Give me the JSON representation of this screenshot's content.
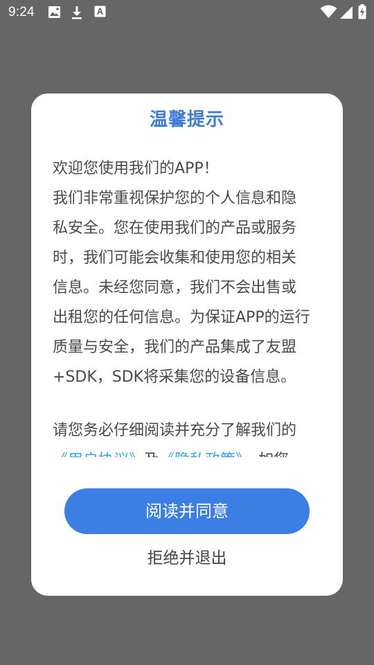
{
  "status_bar": {
    "time": "9:24",
    "left_icons": [
      "image-icon",
      "download-icon",
      "font-icon"
    ],
    "right_icons": [
      "wifi-icon",
      "signal-icon",
      "battery-icon"
    ],
    "icon_color": "#ffffff"
  },
  "dialog": {
    "title": "温馨提示",
    "title_color": "#3d7bd8",
    "paragraph1_lines": [
      "欢迎您使用我们的APP！",
      "我们非常重视保护您的个人信息和隐",
      "私安全。您在使用我们的产品或服务",
      "时，我们可能会收集和使用您的相关",
      "信息。未经您同意，我们不会出售或",
      "出租您的任何信息。为保证APP的运行",
      "质量与安全，我们的产品集成了友盟",
      "+SDK，SDK将采集您的设备信息。"
    ],
    "paragraph2_line1": "请您务必仔细阅读并充分了解我们的",
    "link_user_agreement": "《用户协议》",
    "and_text": "及",
    "link_privacy_policy": "《隐私政策》",
    "continuation_text": "，如您",
    "link_color": "#3aa0e8",
    "agree_label": "阅读并同意",
    "agree_color": "#3b7fe4",
    "reject_label": "拒绝并退出"
  }
}
